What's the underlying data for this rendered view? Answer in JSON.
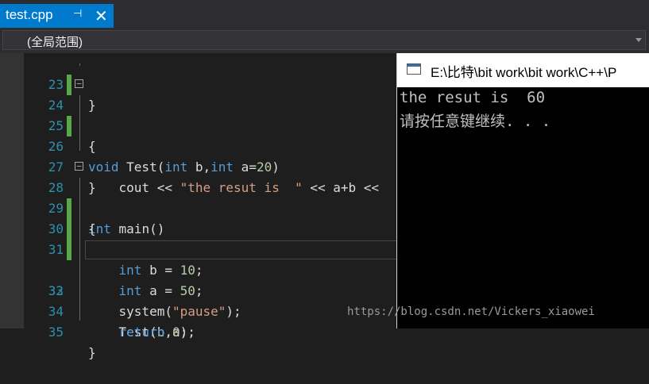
{
  "tab": {
    "title": "test.cpp",
    "pin": "⊣",
    "close": "✕"
  },
  "scope": {
    "label": "(全局范围)"
  },
  "editor": {
    "lines": [
      {
        "num": "23",
        "t": "}"
      },
      {
        "num": "24",
        "kw": "void",
        "t": " Test(",
        "kw2": "int",
        "t2": " b,",
        "kw3": "int",
        "t3": " a=",
        "n": "20",
        "t4": ")"
      },
      {
        "num": "25",
        "t": "{"
      },
      {
        "num": "26",
        "a": "    cout << ",
        "s": "\"the resut is  \"",
        "b": " << a+b <<"
      },
      {
        "num": "27",
        "t": "}"
      },
      {
        "num": "28",
        "kw": "int",
        "t": " main()"
      },
      {
        "num": "29",
        "t": "{"
      },
      {
        "num": "30",
        "kw": "int",
        "t": " b = ",
        "n": "10",
        "t2": ";"
      },
      {
        "num": "31",
        "kw": "int",
        "t": " a = ",
        "n": "50",
        "t2": ";"
      },
      {
        "num": "32",
        "t": "    Test(b,a);"
      },
      {
        "num": "33",
        "a": "    system(",
        "s": "\"pause\"",
        "b": ");"
      },
      {
        "num": "34",
        "kw": "return",
        "t": " ",
        "n": "0",
        "t2": ";"
      },
      {
        "num": "35",
        "t": "}"
      }
    ]
  },
  "console": {
    "title": "E:\\比特\\bit work\\bit work\\C++\\P",
    "lines": [
      "the resut is  60",
      "请按任意键继续. . ."
    ]
  },
  "watermark": "https://blog.csdn.net/Vickers_xiaowei"
}
